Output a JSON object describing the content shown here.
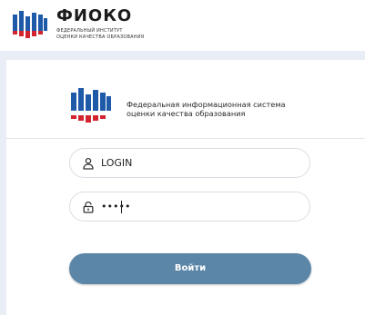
{
  "header": {
    "brand": "ФИОКО",
    "subtitle_line1": "ФЕДЕРАЛЬНЫЙ ИНСТИТУТ",
    "subtitle_line2": "ОЦЕНКИ КАЧЕСТВА ОБРАЗОВАНИЯ"
  },
  "card": {
    "title_line1": "Федеральная информационная система",
    "title_line2": "оценки качества образования"
  },
  "form": {
    "login_value": "LOGIN",
    "password_value": "•••••",
    "submit_label": "Войти"
  },
  "icons": {
    "logo": "fioko-logo-icon",
    "login": "user-icon",
    "password": "lock-icon"
  },
  "colors": {
    "logo_blue": "#1f5aa8",
    "logo_red": "#d3232e",
    "button": "#5b86a8",
    "background": "#e9eef6"
  }
}
